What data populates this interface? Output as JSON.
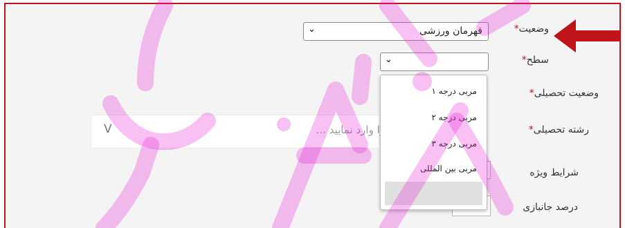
{
  "form": {
    "status_label": "وضعیت",
    "status_value": "قهرمان ورزشی",
    "level_label": "سطح",
    "level_value": "",
    "education_status_label": "وضعیت تحصیلی",
    "education_field_label": "رشته تحصیلی",
    "education_field_placeholder": "را وارد نمایید ...",
    "special_conditions_label": "شرایط ویژه",
    "veteran_percent_label": "درصد جانبازی",
    "required_mark": "*",
    "chevron": "⌄",
    "chevron_large": "V"
  },
  "level_dropdown": {
    "options": [
      "مربی درجه ۱",
      "مربی درجه ۲",
      "مربی درجه ۳",
      "مربی بین المللی",
      ""
    ]
  },
  "annotation": {
    "arrow_color": "#c0141a"
  },
  "colors": {
    "accent": "#c0141a",
    "watermark": "#e51ed4"
  }
}
